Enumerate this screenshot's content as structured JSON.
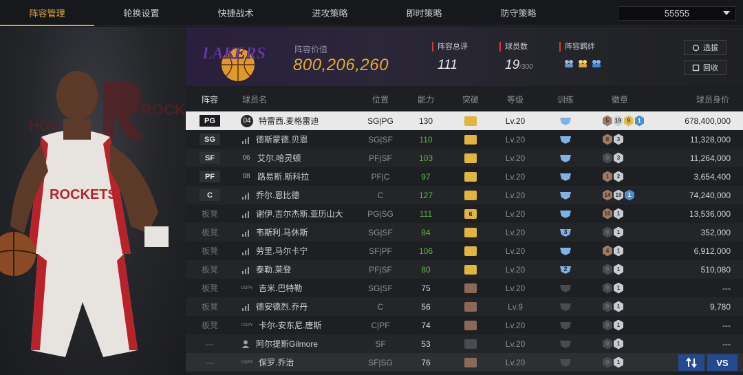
{
  "tabs": [
    {
      "label": "阵容管理",
      "active": true
    },
    {
      "label": "轮换设置",
      "active": false
    },
    {
      "label": "快捷战术",
      "active": false
    },
    {
      "label": "进攻策略",
      "active": false
    },
    {
      "label": "即时策略",
      "active": false
    },
    {
      "label": "防守策略",
      "active": false
    }
  ],
  "dropdown": {
    "value": "55555"
  },
  "header": {
    "lineup_value_label": "阵容价值",
    "lineup_value": "800,206,260",
    "rating_label": "阵容总评",
    "rating_value": "111",
    "players_label": "球员数",
    "players_value": "19",
    "players_max": "/300",
    "chemistry_label": "阵容羁绊",
    "select_button": "选拔",
    "recycle_button": "回收"
  },
  "columns": {
    "pos": "阵容",
    "name": "球员名",
    "position": "位置",
    "ability": "能力",
    "breakthrough": "突破",
    "level": "等级",
    "training": "训练",
    "badges": "徽章",
    "price": "球员身价"
  },
  "rows": [
    {
      "slot": "PG",
      "tag": "04",
      "tagType": "num",
      "name": "特雷西.麦格雷迪",
      "position": "SG|PG",
      "ability": "130",
      "crown": "gold",
      "level": "Lv.20",
      "training": "",
      "badges": [
        "5",
        "19",
        "9",
        "1"
      ],
      "price": "678,400,000"
    },
    {
      "slot": "SG",
      "tag": "",
      "tagType": "bars",
      "name": "德斯蒙德.贝恩",
      "position": "SG|SF",
      "ability": "110",
      "crown": "gold",
      "level": "Lv.20",
      "training": "",
      "badges": [
        "8",
        "3"
      ],
      "price": "11,328,000"
    },
    {
      "slot": "SF",
      "tag": "06",
      "tagType": "plain",
      "name": "艾尔.哈灵顿",
      "position": "PF|SF",
      "ability": "103",
      "crown": "gold",
      "level": "Lv.20",
      "training": "",
      "badges": [
        "0",
        "3"
      ],
      "price": "11,264,000"
    },
    {
      "slot": "PF",
      "tag": "08",
      "tagType": "plain",
      "name": "路易斯.斯科拉",
      "position": "PF|C",
      "ability": "97",
      "crown": "gold",
      "level": "Lv.20",
      "training": "",
      "badges": [
        "1",
        "2"
      ],
      "price": "3,654,400"
    },
    {
      "slot": "C",
      "tag": "",
      "tagType": "bars",
      "name": "乔尔.恩比德",
      "position": "C",
      "ability": "127",
      "crown": "gold",
      "level": "Lv.20",
      "training": "",
      "badges": [
        "14",
        "19",
        "1"
      ],
      "price": "74,240,000"
    },
    {
      "slot": "板凳",
      "tag": "",
      "tagType": "bars",
      "name": "谢伊.吉尔杰斯.亚历山大",
      "position": "PG|SG",
      "ability": "111",
      "crown": "gold",
      "crownText": "6",
      "level": "Lv.20",
      "training": "",
      "badges": [
        "10",
        "1"
      ],
      "price": "13,536,000"
    },
    {
      "slot": "板凳",
      "tag": "",
      "tagType": "bars",
      "name": "韦斯利.马休斯",
      "position": "SG|SF",
      "ability": "84",
      "crown": "gold",
      "level": "Lv.20",
      "training": "3",
      "badges": [
        "0",
        "1"
      ],
      "price": "352,000"
    },
    {
      "slot": "板凳",
      "tag": "",
      "tagType": "bars",
      "name": "劳里.马尔卡宁",
      "position": "SF|PF",
      "ability": "106",
      "crown": "gold",
      "level": "Lv.20",
      "training": "",
      "badges": [
        "4",
        "1"
      ],
      "price": "6,912,000"
    },
    {
      "slot": "板凳",
      "tag": "",
      "tagType": "bars",
      "name": "泰勒.莱登",
      "position": "PF|SF",
      "ability": "80",
      "crown": "gold",
      "level": "Lv.20",
      "training": "2",
      "badges": [
        "0",
        "1"
      ],
      "price": "510,080"
    },
    {
      "slot": "板凳",
      "tag": "COPY",
      "tagType": "copy",
      "name": "吉米.巴特勒",
      "position": "SG|SF",
      "ability": "75",
      "crown": "bronze",
      "level": "Lv.20",
      "training": "",
      "badges": [
        "0",
        "1"
      ],
      "price": "---"
    },
    {
      "slot": "板凳",
      "tag": "",
      "tagType": "bars",
      "name": "德安德烈.乔丹",
      "position": "C",
      "ability": "56",
      "crown": "bronze",
      "level": "Lv.9",
      "training": "",
      "badges": [
        "0",
        "1"
      ],
      "price": "9,780"
    },
    {
      "slot": "板凳",
      "tag": "COPY",
      "tagType": "copy",
      "name": "卡尔-安东尼.唐斯",
      "position": "C|PF",
      "ability": "74",
      "crown": "bronze",
      "level": "Lv.20",
      "training": "",
      "badges": [
        "0",
        "1"
      ],
      "price": "---"
    },
    {
      "slot": "---",
      "tag": "",
      "tagType": "person",
      "name": "阿尔提斯Gilmore",
      "position": "SF",
      "ability": "53",
      "crown": "gray",
      "level": "Lv.20",
      "training": "",
      "badges": [
        "0",
        "1"
      ],
      "price": "---"
    },
    {
      "slot": "---",
      "tag": "COPY",
      "tagType": "copy",
      "name": "保罗.乔治",
      "position": "SF|SG",
      "ability": "76",
      "crown": "bronze",
      "level": "Lv.20",
      "training": "",
      "badges": [
        "0",
        "1"
      ],
      "price": "---"
    }
  ],
  "buttons": {
    "vs": "VS"
  },
  "colors": {
    "accent": "#e3a93a",
    "selected_row": "#e9e9e9",
    "ability_green": "#5fb24a",
    "crown_gold": "#e0b63f"
  }
}
